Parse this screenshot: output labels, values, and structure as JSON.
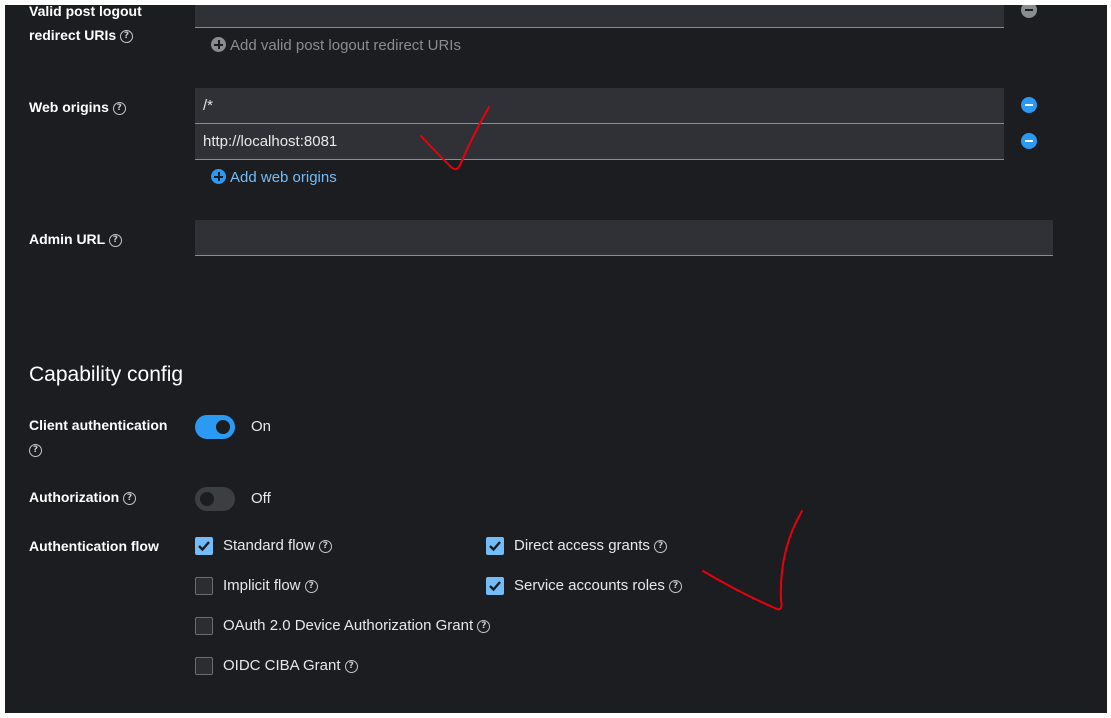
{
  "post_logout": {
    "label_line1": "Valid post logout",
    "label_line2": "redirect URIs",
    "add_label": "Add valid post logout redirect URIs"
  },
  "web_origins": {
    "label": "Web origins",
    "values": [
      "/*",
      "http://localhost:8081"
    ],
    "add_label": "Add web origins"
  },
  "admin_url": {
    "label": "Admin URL",
    "value": ""
  },
  "capability": {
    "title": "Capability config",
    "client_auth": {
      "label": "Client authentication",
      "state": "On",
      "on": true
    },
    "authorization": {
      "label": "Authorization",
      "state": "Off",
      "on": false
    },
    "auth_flow": {
      "label": "Authentication flow",
      "options": [
        {
          "label": "Standard flow",
          "checked": true
        },
        {
          "label": "Direct access grants",
          "checked": true
        },
        {
          "label": "Implicit flow",
          "checked": false
        },
        {
          "label": "Service accounts roles",
          "checked": true
        },
        {
          "label": "OAuth 2.0 Device Authorization Grant",
          "checked": false
        },
        {
          "label": "OIDC CIBA Grant",
          "checked": false
        }
      ]
    }
  },
  "colors": {
    "background": "#1b1d21",
    "accent": "#2b9af3",
    "link": "#73bcf7",
    "annotation": "#e8000b"
  },
  "help_glyph": "?"
}
